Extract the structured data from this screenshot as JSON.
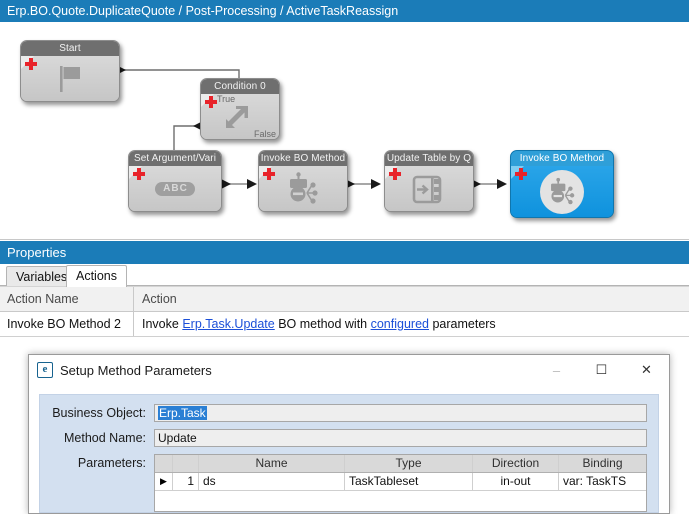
{
  "breadcrumb": {
    "text": "Erp.BO.Quote.DuplicateQuote / Post-Processing / ActiveTaskReassign"
  },
  "canvas": {
    "nodes": [
      {
        "id": "start",
        "title": "Start",
        "icon": "flag-icon",
        "selected": false,
        "badge": "plus-badge"
      },
      {
        "id": "cond0",
        "title": "Condition 0",
        "icon": "branch-arrow-icon",
        "selected": false,
        "badge": "plus-badge",
        "true_label": "True",
        "false_label": "False"
      },
      {
        "id": "setarg",
        "title": "Set Argument/Vari",
        "icon": "abc-icon",
        "selected": false,
        "badge": "plus-badge",
        "pill": "ABC"
      },
      {
        "id": "invoke1",
        "title": "Invoke BO Method",
        "icon": "bo-method-icon",
        "selected": false,
        "badge": "plus-badge"
      },
      {
        "id": "updtable",
        "title": "Update Table by Q",
        "icon": "update-table-icon",
        "selected": false,
        "badge": "plus-badge"
      },
      {
        "id": "invoke2",
        "title": "Invoke BO Method",
        "icon": "bo-method-icon",
        "selected": true,
        "badge": "plus-badge"
      }
    ]
  },
  "properties": {
    "header": "Properties",
    "tabs": [
      {
        "id": "variables",
        "label": "Variables",
        "active": false
      },
      {
        "id": "actions",
        "label": "Actions",
        "active": true
      }
    ],
    "action_grid": {
      "columns": [
        "Action Name",
        "Action"
      ],
      "rows": [
        {
          "name": "Invoke BO Method 2",
          "action_pre": "Invoke ",
          "action_link1": "Erp.Task.Update",
          "action_mid": " BO method with ",
          "action_link2": "configured",
          "action_post": " parameters"
        }
      ]
    }
  },
  "dialog": {
    "title": "Setup Method Parameters",
    "app_icon": "epicor-e-icon",
    "window_buttons": {
      "minimize": "–",
      "maximize": "☐",
      "close": "✕"
    },
    "fields": {
      "business_object_label": "Business Object:",
      "business_object_value": "Erp.Task",
      "method_name_label": "Method Name:",
      "method_name_value": "Update",
      "parameters_label": "Parameters:"
    },
    "params_grid": {
      "columns": [
        "",
        "",
        "Name",
        "Type",
        "Direction",
        "Binding"
      ],
      "rows": [
        {
          "indicator": "▶",
          "num": "1",
          "name": "ds",
          "type": "TaskTableset",
          "direction": "in-out",
          "binding": "var: TaskTS"
        }
      ]
    }
  },
  "colors": {
    "accent_blue": "#1b7cb8",
    "selected_node": "#1c9ee2",
    "link": "#1b4fd8",
    "badge_red": "#e8232a",
    "dialog_panel": "#d3e0f0"
  }
}
